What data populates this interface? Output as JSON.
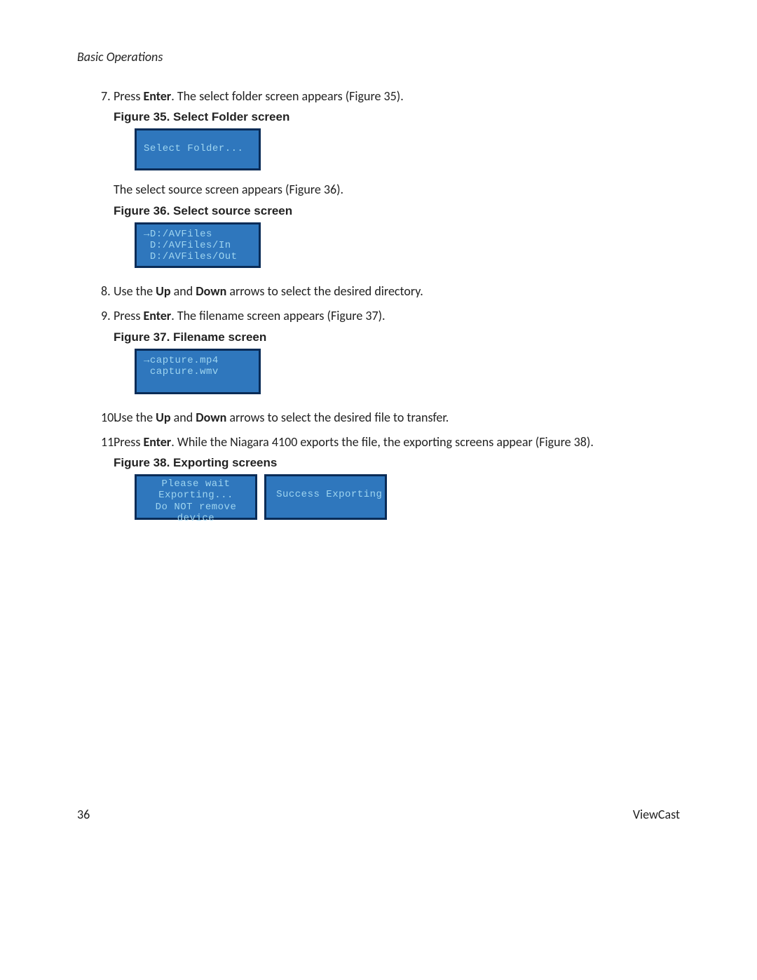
{
  "header": "Basic Operations",
  "steps": {
    "s7": {
      "num": "7.",
      "line1_a": "Press ",
      "line1_b": "Enter",
      "line1_c": ". The select folder screen appears (Figure 35).",
      "fig35_caption": "Figure 35. Select Folder screen",
      "fig35_lcd": "Select Folder...",
      "line2": "The select source screen appears (Figure 36).",
      "fig36_caption": "Figure 36. Select source screen",
      "fig36_lcd": "→D:/AVFiles\n D:/AVFiles/In\n D:/AVFiles/Out"
    },
    "s8": {
      "num": "8.",
      "a": "Use the ",
      "b": "Up",
      "c": " and ",
      "d": "Down",
      "e": " arrows to select the desired directory."
    },
    "s9": {
      "num": "9.",
      "a": "Press ",
      "b": "Enter",
      "c": ". The filename screen appears (Figure 37).",
      "fig37_caption": "Figure 37. Filename screen",
      "fig37_lcd": "→capture.mp4\n capture.wmv"
    },
    "s10": {
      "num": "10.",
      "a": "Use the ",
      "b": "Up",
      "c": " and ",
      "d": "Down",
      "e": " arrows to select the desired file to transfer."
    },
    "s11": {
      "num": "11.",
      "a": "Press ",
      "b": "Enter",
      "c": ". While the Niagara 4100 exports the file, the exporting screens appear (Figure 38).",
      "fig38_caption": "Figure 38. Exporting screens",
      "fig38_lcd_a": "Please wait\nExporting...\nDo NOT remove\ndevice",
      "fig38_lcd_b": "Success Exporting"
    }
  },
  "footer": {
    "page": "36",
    "brand": "ViewCast"
  }
}
